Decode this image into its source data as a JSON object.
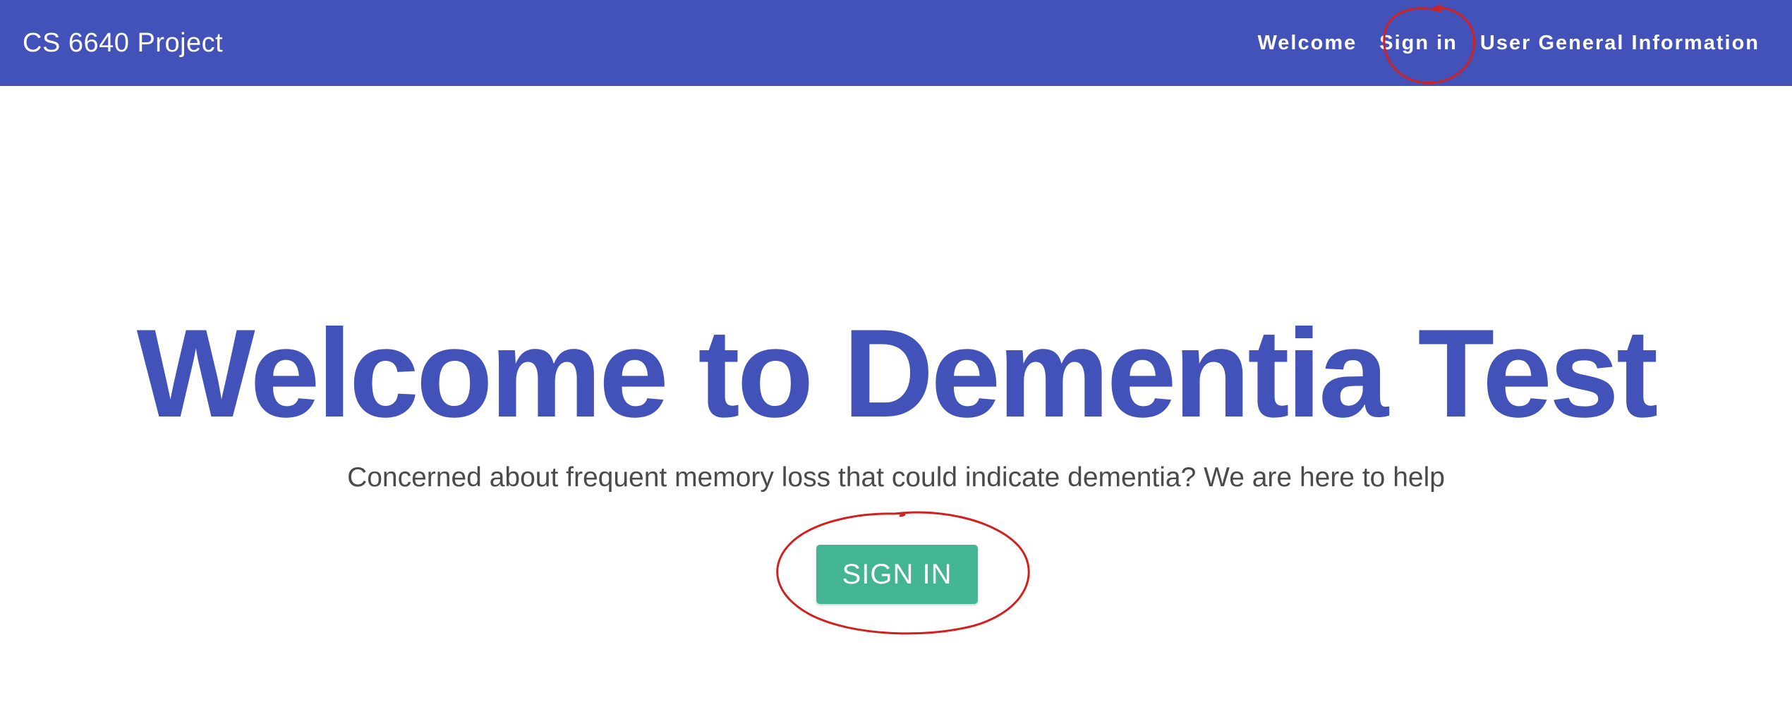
{
  "navbar": {
    "brand": "CS 6640 Project",
    "links": [
      {
        "label": "Welcome"
      },
      {
        "label": "Sign in"
      },
      {
        "label": "User General Information"
      }
    ]
  },
  "hero": {
    "title": "Welcome to Dementia Test",
    "subtitle": "Concerned about frequent memory loss that could indicate dementia? We are here to help",
    "button_label": "SIGN IN"
  },
  "colors": {
    "navbar_bg": "#4352b8",
    "title": "#4352b8",
    "button_bg": "#43b494",
    "annotation": "#d41f1f"
  }
}
